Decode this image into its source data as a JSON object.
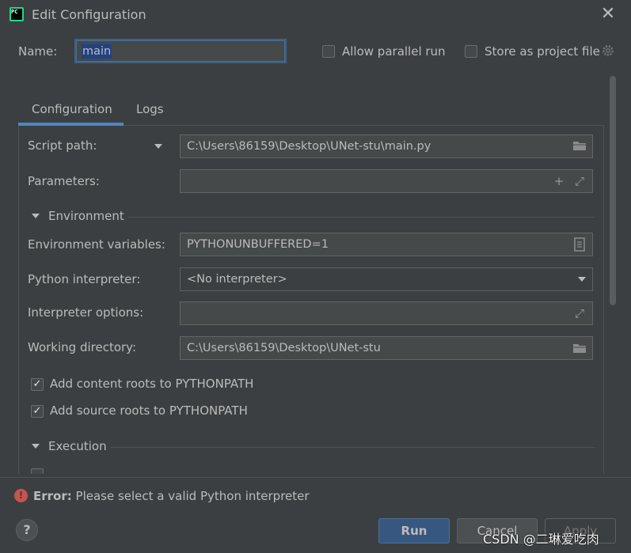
{
  "window": {
    "title": "Edit Configuration",
    "app_icon_text": "PC"
  },
  "header": {
    "name_label": "Name:",
    "name_value": "main",
    "allow_parallel_label": "Allow parallel run",
    "store_project_label": "Store as project file"
  },
  "tabs": [
    {
      "label": "Configuration",
      "active": true
    },
    {
      "label": "Logs",
      "active": false
    }
  ],
  "form": {
    "script_path_label": "Script path:",
    "script_path_value": "C:\\Users\\86159\\Desktop\\UNet-stu\\main.py",
    "parameters_label": "Parameters:",
    "parameters_value": "",
    "environment_section": "Environment",
    "env_vars_label": "Environment variables:",
    "env_vars_value": "PYTHONUNBUFFERED=1",
    "interpreter_label": "Python interpreter:",
    "interpreter_value": "<No interpreter>",
    "interp_options_label": "Interpreter options:",
    "interp_options_value": "",
    "working_dir_label": "Working directory:",
    "working_dir_value": "C:\\Users\\86159\\Desktop\\UNet-stu",
    "content_roots_label": "Add content roots to PYTHONPATH",
    "content_roots_checked": true,
    "source_roots_label": "Add source roots to PYTHONPATH",
    "source_roots_checked": true,
    "execution_section": "Execution"
  },
  "status": {
    "error_prefix": "Error:",
    "error_message": " Please select a valid Python interpreter"
  },
  "buttons": {
    "help": "?",
    "run": "Run",
    "cancel": "Cancel",
    "apply": "Apply"
  },
  "watermark": "CSDN @二琳爱吃肉",
  "colors": {
    "background": "#3c3f41",
    "field_bg": "#45494a",
    "accent": "#4a88c7",
    "error": "#c75450",
    "run_button": "#365880"
  }
}
